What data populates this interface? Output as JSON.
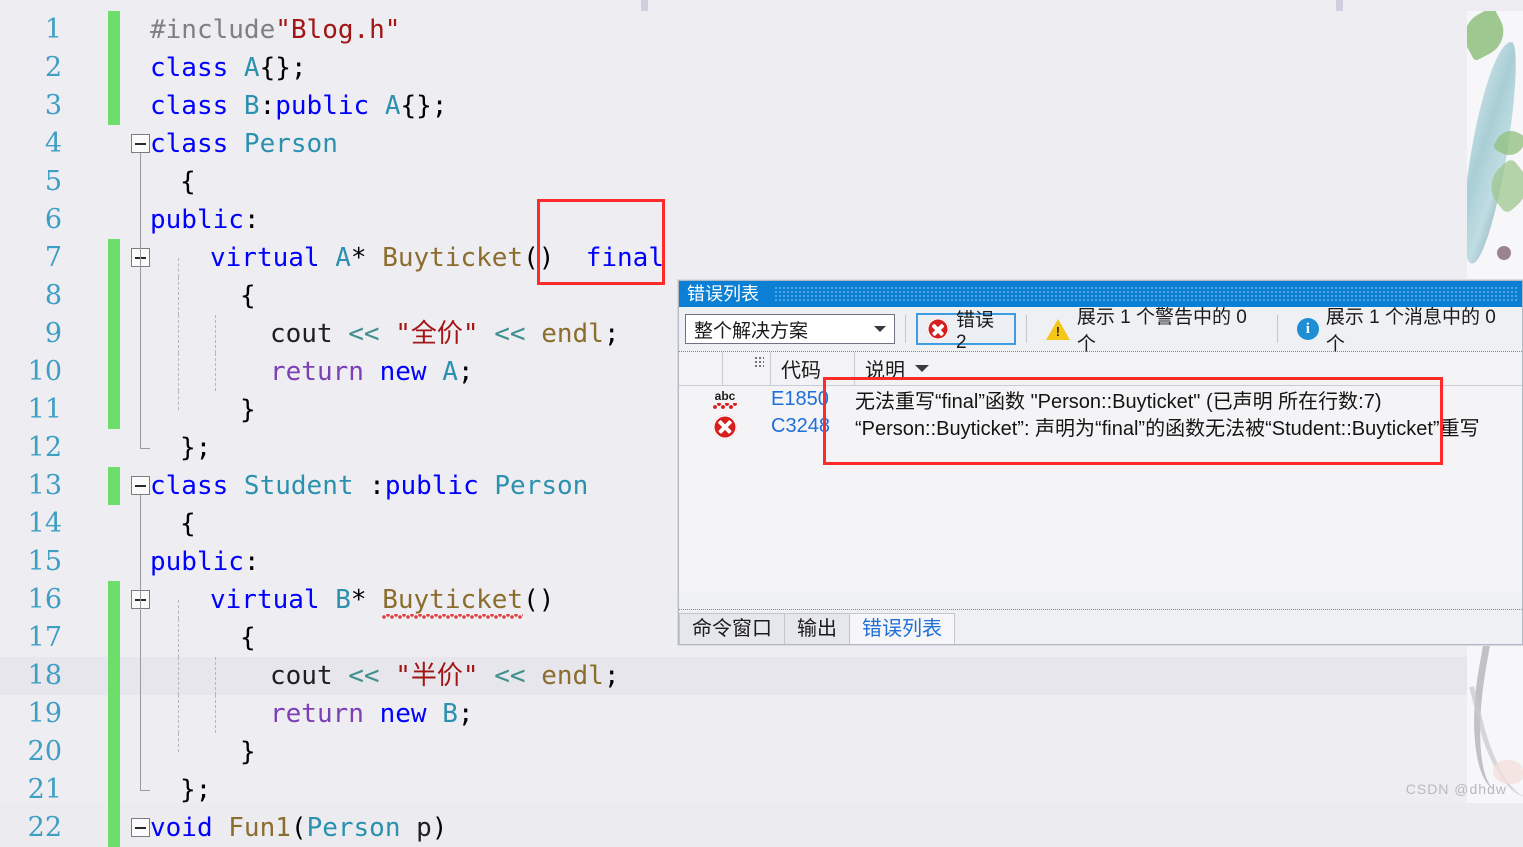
{
  "editor": {
    "language": "cpp",
    "lines": [
      {
        "n": "1",
        "indent": 0,
        "tokens": [
          {
            "t": "#include",
            "c": "pp"
          },
          {
            "t": "\"Blog.h\"",
            "c": "str"
          }
        ]
      },
      {
        "n": "2",
        "indent": 0,
        "tokens": [
          {
            "t": "class ",
            "c": "kw"
          },
          {
            "t": "A",
            "c": "typ"
          },
          {
            "t": "{};",
            "c": "pl"
          }
        ]
      },
      {
        "n": "3",
        "indent": 0,
        "tokens": [
          {
            "t": "class ",
            "c": "kw"
          },
          {
            "t": "B",
            "c": "typ"
          },
          {
            "t": ":",
            "c": "pl"
          },
          {
            "t": "public ",
            "c": "kw"
          },
          {
            "t": "A",
            "c": "typ"
          },
          {
            "t": "{};",
            "c": "pl"
          }
        ]
      },
      {
        "n": "4",
        "indent": 0,
        "tokens": [
          {
            "t": "class ",
            "c": "kw"
          },
          {
            "t": "Person",
            "c": "typ"
          }
        ]
      },
      {
        "n": "5",
        "indent": 1,
        "tokens": [
          {
            "t": "{",
            "c": "pl"
          }
        ]
      },
      {
        "n": "6",
        "indent": 0,
        "tokens": [
          {
            "t": "public",
            "c": "kw"
          },
          {
            "t": ":",
            "c": "pl"
          }
        ]
      },
      {
        "n": "7",
        "indent": 2,
        "tokens": [
          {
            "t": "virtual ",
            "c": "kw"
          },
          {
            "t": "A",
            "c": "typ"
          },
          {
            "t": "* ",
            "c": "pl"
          },
          {
            "t": "Buyticket",
            "c": "fn"
          },
          {
            "t": "()  ",
            "c": "pl"
          },
          {
            "t": "final",
            "c": "kw"
          }
        ]
      },
      {
        "n": "8",
        "indent": 3,
        "tokens": [
          {
            "t": "{",
            "c": "pl"
          }
        ]
      },
      {
        "n": "9",
        "indent": 4,
        "tokens": [
          {
            "t": "cout ",
            "c": "id"
          },
          {
            "t": "<< ",
            "c": "op"
          },
          {
            "t": "\"全价\" ",
            "c": "str"
          },
          {
            "t": "<< ",
            "c": "op"
          },
          {
            "t": "endl",
            "c": "fn"
          },
          {
            "t": ";",
            "c": "pl"
          }
        ]
      },
      {
        "n": "10",
        "indent": 4,
        "tokens": [
          {
            "t": "return ",
            "c": "num"
          },
          {
            "t": "new ",
            "c": "kw"
          },
          {
            "t": "A",
            "c": "typ"
          },
          {
            "t": ";",
            "c": "pl"
          }
        ]
      },
      {
        "n": "11",
        "indent": 3,
        "tokens": [
          {
            "t": "}",
            "c": "pl"
          }
        ]
      },
      {
        "n": "12",
        "indent": 1,
        "tokens": [
          {
            "t": "};",
            "c": "pl"
          }
        ]
      },
      {
        "n": "13",
        "indent": 0,
        "tokens": [
          {
            "t": "class ",
            "c": "kw"
          },
          {
            "t": "Student ",
            "c": "typ"
          },
          {
            "t": ":",
            "c": "pl"
          },
          {
            "t": "public ",
            "c": "kw"
          },
          {
            "t": "Person",
            "c": "typ"
          }
        ]
      },
      {
        "n": "14",
        "indent": 1,
        "tokens": [
          {
            "t": "{",
            "c": "pl"
          }
        ]
      },
      {
        "n": "15",
        "indent": 0,
        "tokens": [
          {
            "t": "public",
            "c": "kw"
          },
          {
            "t": ":",
            "c": "pl"
          }
        ]
      },
      {
        "n": "16",
        "indent": 2,
        "tokens": [
          {
            "t": "virtual ",
            "c": "kw"
          },
          {
            "t": "B",
            "c": "typ"
          },
          {
            "t": "* ",
            "c": "pl"
          },
          {
            "t": "Buyticket",
            "c": "fn squig"
          },
          {
            "t": "()",
            "c": "pl"
          }
        ]
      },
      {
        "n": "17",
        "indent": 3,
        "tokens": [
          {
            "t": "{",
            "c": "pl"
          }
        ]
      },
      {
        "n": "18",
        "indent": 4,
        "tokens": [
          {
            "t": "cout ",
            "c": "id"
          },
          {
            "t": "<< ",
            "c": "op"
          },
          {
            "t": "\"半价\" ",
            "c": "str"
          },
          {
            "t": "<< ",
            "c": "op"
          },
          {
            "t": "endl",
            "c": "fn"
          },
          {
            "t": ";",
            "c": "pl"
          }
        ]
      },
      {
        "n": "19",
        "indent": 4,
        "tokens": [
          {
            "t": "return ",
            "c": "num"
          },
          {
            "t": "new ",
            "c": "kw"
          },
          {
            "t": "B",
            "c": "typ"
          },
          {
            "t": ";",
            "c": "pl"
          }
        ]
      },
      {
        "n": "20",
        "indent": 3,
        "tokens": [
          {
            "t": "}",
            "c": "pl"
          }
        ]
      },
      {
        "n": "21",
        "indent": 1,
        "tokens": [
          {
            "t": "};",
            "c": "pl"
          }
        ]
      },
      {
        "n": "22",
        "indent": 0,
        "tokens": [
          {
            "t": "void ",
            "c": "kw"
          },
          {
            "t": "Fun1",
            "c": "fn"
          },
          {
            "t": "(",
            "c": "pl"
          },
          {
            "t": "Person ",
            "c": "typ"
          },
          {
            "t": "p",
            "c": "id"
          },
          {
            "t": ")",
            "c": "pl"
          }
        ]
      }
    ],
    "annotation_box_label": "final-highlight"
  },
  "error_list": {
    "title": "错误列表",
    "scope": {
      "value": "整个解决方案",
      "caret_icon": "chevron-down-icon"
    },
    "filters": [
      {
        "id": "errors",
        "icon": "error-circle-icon",
        "label": "错误 2",
        "active": true
      },
      {
        "id": "warnings",
        "icon": "warning-triangle-icon",
        "label": "展示 1 个警告中的 0 个",
        "active": false
      },
      {
        "id": "messages",
        "icon": "info-circle-icon",
        "label": "展示 1 个消息中的 0 个",
        "active": false
      }
    ],
    "columns": [
      "",
      "",
      "代码",
      "说明"
    ],
    "sort_column": "说明",
    "rows": [
      {
        "icon": "abc-squiggle-icon",
        "code": "E1850",
        "description": "无法重写“final”函数 \"Person::Buyticket\" (已声明 所在行数:7)"
      },
      {
        "icon": "error-circle-icon",
        "code": "C3248",
        "description": "“Person::Buyticket”: 声明为“final”的函数无法被“Student::Buyticket”重写"
      }
    ],
    "tabs": [
      {
        "label": "命令窗口",
        "selected": false
      },
      {
        "label": "输出",
        "selected": false
      },
      {
        "label": "错误列表",
        "selected": true
      }
    ]
  },
  "watermark": {
    "text": "CSDN @dhdw"
  },
  "colors": {
    "title_bar": "#0b7fd4",
    "annotation_red": "#ff2a2a",
    "change_bar_green": "#6ede6b",
    "code_keyword": "#0000ff",
    "code_type": "#2b91af",
    "code_string": "#a31515",
    "code_function": "#8b6d2e",
    "link_blue": "#1e6fd9"
  }
}
